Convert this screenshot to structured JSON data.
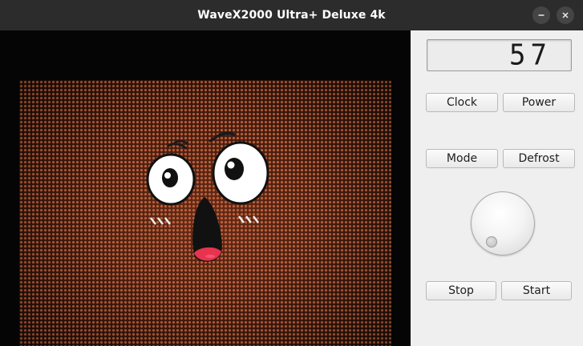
{
  "window": {
    "title": "WaveX2000 Ultra+ Deluxe 4k"
  },
  "display": {
    "value": "57"
  },
  "buttons": {
    "clock": "Clock",
    "power": "Power",
    "mode": "Mode",
    "defrost": "Defrost",
    "stop": "Stop",
    "start": "Start"
  },
  "colors": {
    "panel": "#efefef",
    "titlebar": "#2c2c2c",
    "mesh": "#d26e46",
    "mouth": "#e8334f"
  },
  "icons": {
    "minimize": "minimize-icon",
    "close": "close-icon",
    "face": "surprised-face-icon"
  }
}
